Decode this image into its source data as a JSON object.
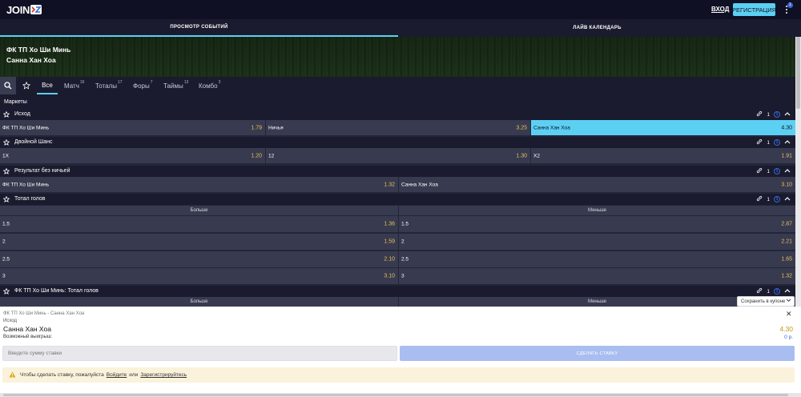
{
  "brand": {
    "logo_text": "JOIN"
  },
  "header": {
    "login_label": "ВХОД",
    "register_label": "РЕГИСТРАЦИЯ",
    "menu_badge": "1"
  },
  "nav": {
    "tabs": [
      {
        "label": "ПРОСМОТР СОБЫТИЙ",
        "active": true
      },
      {
        "label": "ЛАЙВ КАЛЕНДАРЬ",
        "active": false
      }
    ]
  },
  "event": {
    "team1": "ФК ТП Хо Ши Минь",
    "team2": "Санна Хан Хоа"
  },
  "filters": {
    "tabs": [
      {
        "label": "Все",
        "count": ""
      },
      {
        "label": "Матч",
        "count": "16"
      },
      {
        "label": "Тоталы",
        "count": "17"
      },
      {
        "label": "Форы",
        "count": "7"
      },
      {
        "label": "Таймы",
        "count": "13"
      },
      {
        "label": "Комбо",
        "count": "3"
      }
    ]
  },
  "markets_title": "Маркеты",
  "markets": [
    {
      "title": "Исход",
      "link_count": "1",
      "outcomes": [
        {
          "label": "ФК ТП Хо Ши Минь",
          "odd": "1.79"
        },
        {
          "label": "Ничья",
          "odd": "3.25"
        },
        {
          "label": "Санна Хан Хоа",
          "odd": "4.30",
          "selected": true
        }
      ]
    },
    {
      "title": "Двойной Шанс",
      "link_count": "1",
      "outcomes": [
        {
          "label": "1X",
          "odd": "1.20"
        },
        {
          "label": "12",
          "odd": "1.30"
        },
        {
          "label": "X2",
          "odd": "1.91"
        }
      ]
    },
    {
      "title": "Результат без ничьей",
      "link_count": "1",
      "outcomes": [
        {
          "label": "ФК ТП Хо Ши Минь",
          "odd": "1.32"
        },
        {
          "label": "Санна Хан Хоа",
          "odd": "3.10"
        }
      ]
    },
    {
      "title": "Тотал голов",
      "link_count": "1",
      "columns": [
        "Больше",
        "Меньше"
      ],
      "rows": [
        {
          "over_label": "1.5",
          "over_odd": "1.36",
          "under_label": "1.5",
          "under_odd": "2.87"
        },
        {
          "over_label": "2",
          "over_odd": "1.59",
          "under_label": "2",
          "under_odd": "2.21"
        },
        {
          "over_label": "2.5",
          "over_odd": "2.10",
          "under_label": "2.5",
          "under_odd": "1.65"
        },
        {
          "over_label": "3",
          "over_odd": "3.10",
          "under_label": "3",
          "under_odd": "1.32"
        }
      ]
    },
    {
      "title": "ФК ТП Хо Ши Минь: Тотал голов",
      "link_count": "1",
      "columns": [
        "Больше",
        "Меньше"
      ]
    }
  ],
  "coupon": {
    "chip_label": "Сохранить в купоне",
    "match": "ФК ТП Хо Ши Минь - Санна Хан Хоа",
    "market": "Исход",
    "pick": "Санна Хан Хоа",
    "odd": "4.30",
    "win_label": "Возможный выигрыш:",
    "win_value": "0 р.",
    "stake_placeholder": "Введите сумму ставки",
    "bet_button": "СДЕЛАТЬ СТАВКУ",
    "warning_text": "Чтобы сделать ставку, пожалуйста",
    "warning_login": "Войдите",
    "warning_or": "или",
    "warning_register": "Зарегистрируйтесь"
  },
  "colors": {
    "accent": "#5cd0f3",
    "background": "#232538",
    "odds": "#e3c15a",
    "cell": "#383a4f",
    "header": "#1a1b2e"
  }
}
